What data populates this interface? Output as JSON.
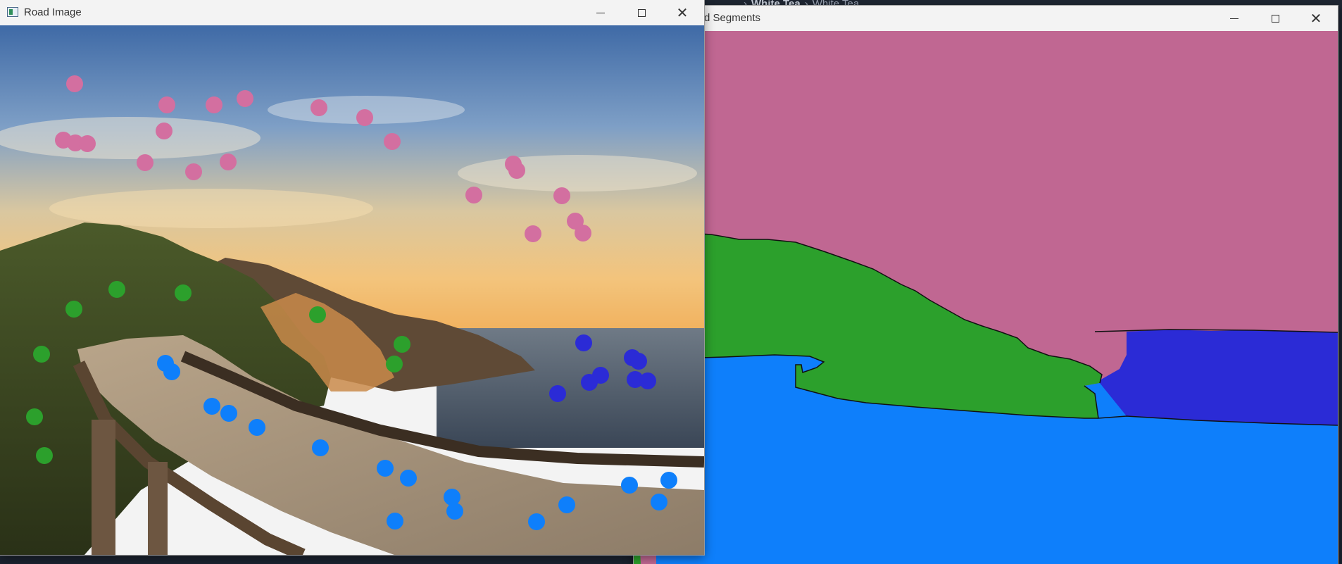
{
  "background": {
    "breadcrumb": [
      "",
      "White Tea",
      "White Tea"
    ]
  },
  "windows": {
    "segments": {
      "title": "d Segments",
      "controls": {
        "minimize": "minimize",
        "maximize": "maximize",
        "close": "close"
      }
    },
    "road": {
      "title": "Road Image",
      "controls": {
        "minimize": "minimize",
        "maximize": "maximize",
        "close": "close"
      }
    }
  },
  "segment_colors": {
    "sky": "#c06792",
    "mountain": "#2ca02c",
    "ocean": "#2b2bd6",
    "road": "#0e7ffb"
  },
  "marker_colors": {
    "sky": "#d36fa0",
    "mountain": "#2ca02c",
    "ocean": "#2b2bd6",
    "road": "#0e7ffb"
  },
  "icons": {
    "app": "app-window-icon"
  }
}
